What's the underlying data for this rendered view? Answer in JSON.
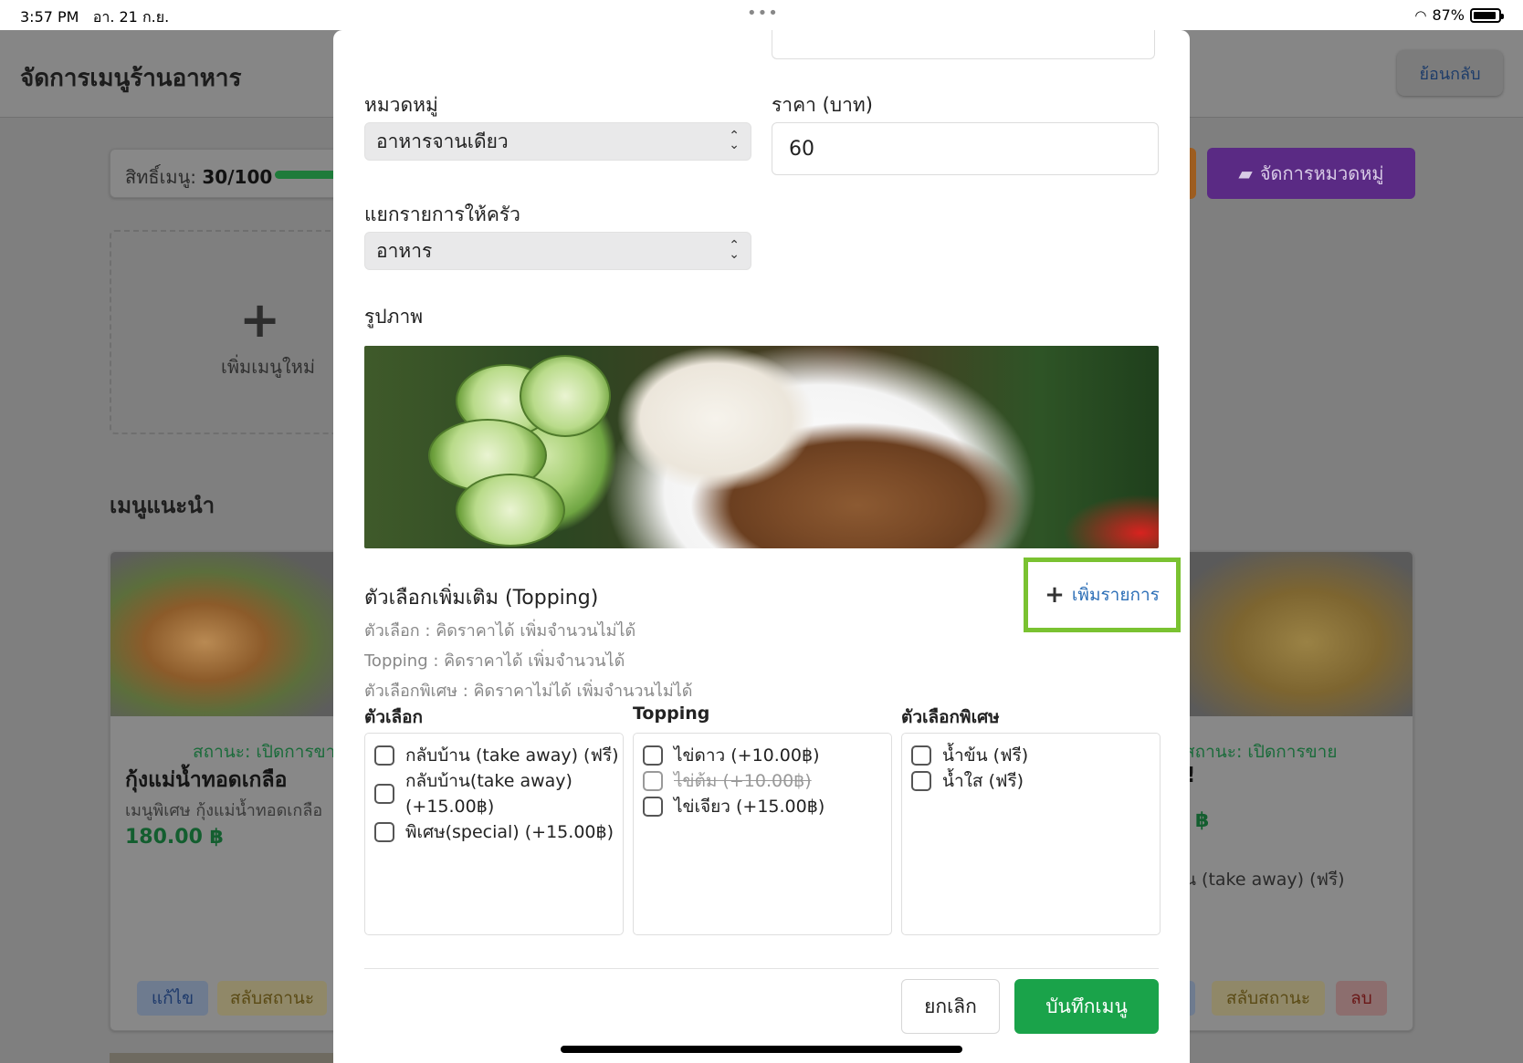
{
  "status_bar": {
    "time": "3:57 PM",
    "date": "อา. 21 ก.ย.",
    "battery": "87%",
    "dots": "•••"
  },
  "background": {
    "title": "จัดการเมนูร้านอาหาร",
    "back_label": "ย้อนกลับ",
    "quota_label": "สิทธิ์เมนู: ",
    "quota_value": "30/100",
    "manage_categories_label": "จัดการหมวดหมู่",
    "add_menu_label": "เพิ่มเมนูใหม่",
    "section_title": "เมนูแนะนำ",
    "card_left": {
      "status": "สถานะ: เปิดการขาย",
      "name": "กุ้งแม่น้ำทอดเกลือ",
      "desc": "เมนูพิเศษ กุ้งแม่น้ำทอดเกลือ",
      "price": "180.00 ฿",
      "edit_label": "แก้ไข",
      "toggle_label": "สลับสถานะ"
    },
    "card_right": {
      "status": "สถานะ: เปิดการขาย",
      "name": "!",
      "price": "฿",
      "option": "น (take away) (ฟรี)",
      "toggle_label": "สลับสถานะ",
      "delete_label": "ลบ"
    }
  },
  "modal": {
    "category_label": "หมวดหมู่",
    "category_value": "อาหารจานเดียว",
    "price_label": "ราคา (บาท)",
    "price_value": "60",
    "kitchen_label": "แยกรายการให้ครัว",
    "kitchen_value": "อาหาร",
    "image_label": "รูปภาพ",
    "topping_title": "ตัวเลือกเพิ่มเติม (Topping)",
    "add_item_label": "เพิ่มรายการ",
    "hints": [
      "ตัวเลือก : คิดราคาได้ เพิ่มจำนวนไม่ได้",
      "Topping : คิดราคาได้ เพิ่มจำนวนได้",
      "ตัวเลือกพิเศษ : คิดราคาไม่ได้ เพิ่มจำนวนไม่ได้"
    ],
    "columns": {
      "options": {
        "title": "ตัวเลือก",
        "items": [
          "กลับบ้าน (take away) (ฟรี)",
          "กลับบ้าน(take away)",
          "(+15.00฿)",
          "พิเศษ(special) (+15.00฿)"
        ]
      },
      "topping": {
        "title": "Topping",
        "items": [
          "ไข่ดาว (+10.00฿)",
          "ไข่ต้ม (+10.00฿)",
          "ไข่เจียว (+15.00฿)"
        ]
      },
      "special": {
        "title": "ตัวเลือกพิเศษ",
        "items": [
          "น้ำข้น (ฟรี)",
          "น้ำใส (ฟรี)"
        ]
      }
    },
    "cancel_label": "ยกเลิก",
    "save_label": "บันทึกเมนู"
  },
  "colors": {
    "save": "#1aa34a",
    "highlight": "#7ac231",
    "link": "#2d6fb7"
  }
}
